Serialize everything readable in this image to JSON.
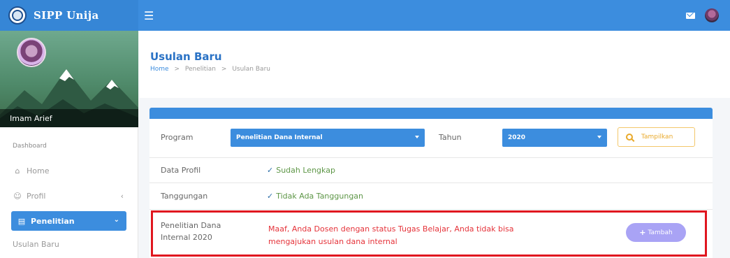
{
  "app": {
    "title": "SIPP Unija"
  },
  "sidebar": {
    "user_name": "Imam Arief",
    "section_header": "Dashboard",
    "items": [
      {
        "label": "Home",
        "icon": "home-icon"
      },
      {
        "label": "Profil",
        "icon": "user-circle-icon"
      },
      {
        "label": "Penelitian",
        "icon": "document-icon"
      }
    ],
    "subitems": [
      {
        "label": "Usulan Baru"
      }
    ]
  },
  "page": {
    "title": "Usulan Baru",
    "breadcrumb": [
      "Home",
      "Penelitian",
      "Usulan Baru"
    ],
    "breadcrumb_sep": ">"
  },
  "filter": {
    "program_label": "Program",
    "program_value": "Penelitian Dana Internal",
    "tahun_label": "Tahun",
    "tahun_value": "2020",
    "button_label": "Tampilkan"
  },
  "rows": [
    {
      "label": "Data Profil",
      "value": "Sudah Lengkap"
    },
    {
      "label": "Tanggungan",
      "value": "Tidak Ada Tanggungan"
    }
  ],
  "highlight": {
    "label_line1": "Penelitian Dana",
    "label_line2": "Internal 2020",
    "warning_line1": "Maaf, Anda Dosen dengan status Tugas Belajar, Anda tidak bisa",
    "warning_line2": "mengajukan usulan dana internal",
    "button_label": "Tambah"
  },
  "colors": {
    "primary": "#3c8dde",
    "warning_text": "#e5333a",
    "highlight_border": "#e0161f",
    "success_text": "#5d9646",
    "tambah_button": "#a9a3f5",
    "tampilkan_accent": "#e9a92a"
  }
}
